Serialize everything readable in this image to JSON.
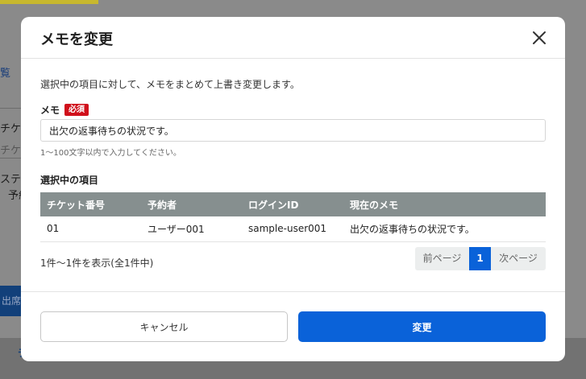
{
  "background": {
    "fragments": [
      "覧",
      "チケッ",
      "チケ",
      "ステー",
      "予約",
      "出席用",
      "チ"
    ]
  },
  "modal": {
    "title": "メモを変更",
    "description": "選択中の項目に対して、メモをまとめて上書き変更します。",
    "memo_label": "メモ",
    "required_badge": "必須",
    "memo_value": "出欠の返事待ちの状況です。",
    "hint": "1〜100文字以内で入力してください。",
    "section_title": "選択中の項目",
    "table": {
      "headers": [
        "チケット番号",
        "予約者",
        "ログインID",
        "現在のメモ"
      ],
      "rows": [
        [
          "01",
          "ユーザー001",
          "sample-user001",
          "出欠の返事待ちの状況です。"
        ]
      ]
    },
    "count_text": "1件〜1件を表示(全1件中)",
    "pager": {
      "prev": "前ページ",
      "current": "1",
      "next": "次ページ"
    },
    "cancel_label": "キャンセル",
    "submit_label": "変更"
  },
  "colors": {
    "primary": "#0a62d9",
    "required": "#d0101b",
    "table_header": "#868f8f"
  }
}
